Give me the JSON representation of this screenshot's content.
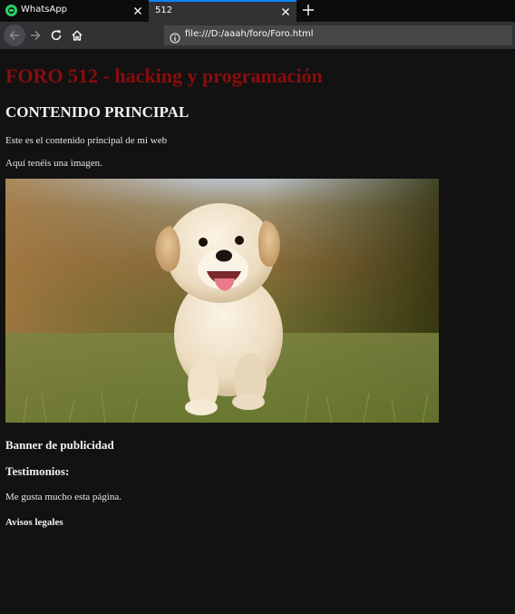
{
  "browser": {
    "tabs": [
      {
        "label": "WhatsApp"
      },
      {
        "label": "512"
      }
    ],
    "url": "file:///D:/aaah/foro/Foro.html"
  },
  "page": {
    "site_title": "FORO 512 - hacking y programación",
    "main_heading": "CONTENIDO PRINCIPAL",
    "intro_text": "Este es el contenido principal de mi web",
    "image_text": "Aquí tenéis una imagen.",
    "image_icon": "puppy-photo",
    "banner_heading": "Banner de publicidad",
    "testimonials_heading": "Testimonios:",
    "testimonial_text": "Me gusta mucho esta página.",
    "legal_heading": "Avisos legales"
  },
  "colors": {
    "accent_tab": "#0a84ff",
    "site_title": "#8b0c0c",
    "background": "#121212"
  }
}
